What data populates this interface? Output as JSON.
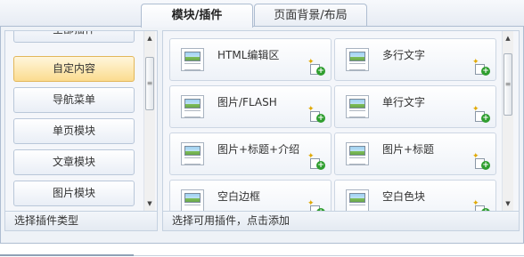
{
  "tabs": [
    {
      "label": "模块/插件",
      "active": true
    },
    {
      "label": "页面背景/布局",
      "active": false
    }
  ],
  "categories": {
    "items": [
      {
        "label": "全部插件"
      },
      {
        "label": "自定内容"
      },
      {
        "label": "导航菜单"
      },
      {
        "label": "单页模块"
      },
      {
        "label": "文章模块"
      },
      {
        "label": "图片模块"
      }
    ],
    "selected": "自定内容",
    "footer": "选择插件类型"
  },
  "plugins": {
    "items": [
      {
        "name": "HTML编辑区"
      },
      {
        "name": "多行文字"
      },
      {
        "name": "图片/FLASH"
      },
      {
        "name": "单行文字"
      },
      {
        "name": "图片+标题+介绍"
      },
      {
        "name": "图片+标题"
      },
      {
        "name": "空白边框"
      },
      {
        "name": "空白色块"
      }
    ],
    "footer": "选择可用插件，点击添加"
  },
  "icons": {
    "plugin_thumbnail": "image-text-icon",
    "add_plugin": "add-plugin-icon",
    "scroll_up": "scroll-up-arrow-icon",
    "scroll_down": "scroll-down-arrow-icon"
  },
  "colors": {
    "selected_bg": "#fbdc8f",
    "panel_bg": "#f4f6fa",
    "border": "#aebdd1",
    "add_green": "#2f9e2f"
  }
}
